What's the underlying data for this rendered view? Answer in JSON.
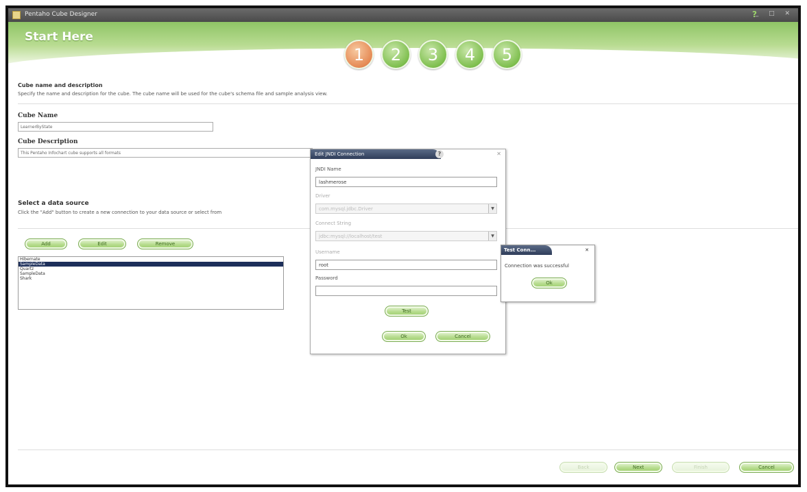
{
  "window": {
    "title": "Pentaho Cube Designer"
  },
  "banner": {
    "heading": "Start Here",
    "steps": [
      "1",
      "2",
      "3",
      "4",
      "5"
    ],
    "active_step": "1"
  },
  "cube_section": {
    "title": "Cube name and description",
    "description": "Specify the name and description for the cube. The cube name will be used for the cube's schema file and sample analysis view."
  },
  "cube_name": {
    "label": "Cube Name",
    "value": "LearnerByState"
  },
  "cube_description": {
    "label": "Cube Description",
    "value": "This Pentaho Infochart cube supports all formats"
  },
  "datasource_section": {
    "title": "Select a data source",
    "description": "Click the \"Add\" button to create a new connection to your data source or select from"
  },
  "datasource_buttons": {
    "add": "Add",
    "edit": "Edit",
    "remove": "Remove"
  },
  "datasource_list": [
    "Hibernate",
    "SampleData",
    "Quartz",
    "SampleData",
    "Shark"
  ],
  "datasource_selected_index": 1,
  "jndi_dialog": {
    "title": "Edit JNDI Connection",
    "jndi_label": "JNDI Name",
    "jndi_value": "lashmerose",
    "driver_label": "Driver",
    "driver_value": "com.mysql.jdbc.Driver",
    "connect_label": "Connect String",
    "connect_value": "jdbc:mysql://localhost/test",
    "username_label": "Username",
    "username_value": "root",
    "password_label": "Password",
    "password_value": "",
    "test_button": "Test",
    "ok_button": "Ok",
    "cancel_button": "Cancel"
  },
  "test_popup": {
    "title": "Test Conn...",
    "message": "Connection was successful",
    "ok_button": "Ok"
  },
  "footer": {
    "back": "Back",
    "next": "Next",
    "finish": "Finish",
    "cancel": "Cancel"
  },
  "colors": {
    "accent_green": "#8fc466",
    "active_step": "#e58a55",
    "selection": "#1d2f5a"
  }
}
